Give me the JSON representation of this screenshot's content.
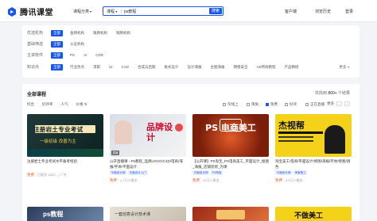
{
  "header": {
    "logo_text": "腾讯课堂",
    "category_label": "课程分类",
    "search_type": "课程",
    "search_value": "ps教程",
    "search_button": "搜索",
    "links": [
      "客户端",
      "浏览历史",
      "登录"
    ]
  },
  "filters": [
    {
      "label": "优选机构",
      "options": [
        "全部",
        "金牌机构",
        "银牌机构",
        "铜牌机构"
      ],
      "more": ""
    },
    {
      "label": "基础筛选",
      "options": [
        "全部",
        "认证机构"
      ],
      "more": ""
    },
    {
      "label": "主讲软件",
      "options": [
        "全部",
        "PS",
        "AI",
        "CDR"
      ],
      "more": ""
    },
    {
      "label": "知识点",
      "options": [
        "全部",
        "行业热点",
        "求职",
        "UI",
        "CAD",
        "合成与后期",
        "板式设计",
        "设计海报",
        "主图海报",
        "网络安全",
        "AE特效教程",
        "产品精修"
      ],
      "more": "更多 ∨"
    }
  ],
  "courses": {
    "title": "全部课程",
    "count_prefix": "共找到",
    "count": "800+",
    "count_suffix": "个结果",
    "sort_options": [
      "综合",
      "好评率",
      "人气",
      "价格 ⇅"
    ],
    "checks": [
      {
        "label": "仅线上",
        "on": false
      },
      {
        "label": "限免",
        "on": false
      },
      {
        "label": "免费",
        "on": true
      },
      {
        "label": "好评",
        "on": false
      },
      {
        "label": "正在直播",
        "on": false
      }
    ],
    "more": "更多",
    "page": "1/25",
    "items": [
      {
        "title": "注册岩土专业考试水平备考经验",
        "tags": [],
        "price": "免费",
        "meta": "已报名 158人",
        "extra": "广东",
        "thumb_text": "注册岩土专业考试",
        "thumb_sub": "一级初级 改善为主",
        "thumb_badge": ""
      },
      {
        "title": "公开直播课 --Ps教程_品牌LOGO/C4D/电商/海报/字体/平面设计",
        "tags": [
          "平面设计师",
          "平面设计入门"
        ],
        "price": "免费",
        "meta": "1.7万人报名",
        "extra": "",
        "thumb_text": "品牌设计",
        "thumb_sub": "",
        "thumb_badge": "直播"
      },
      {
        "title": "【公开课】PS淘宝_PS电商美工_平面设计_抠图_海报_店铺装修_为课",
        "tags": [
          "平面设计师",
          "PS淘宝"
        ],
        "price": "免费",
        "meta": "14万人报名",
        "extra": "",
        "thumb_text": "PS 电商美工",
        "thumb_sub": "",
        "thumb_badge": ""
      },
      {
        "title": "淘宝美工/电商/平面设计/修图/海报/字体/修图/调色",
        "tags": [
          "平面设计师",
          "淘宝美工"
        ],
        "price": "免费",
        "meta": "3.5万人报名",
        "extra": "",
        "thumb_text": "杰视帮",
        "thumb_sub": "",
        "thumb_badge": ""
      }
    ],
    "row2": [
      {
        "text": "ps教程"
      },
      {
        "text": "一套创意设计技术课"
      },
      {
        "text": ""
      },
      {
        "text": "不做美工"
      }
    ]
  },
  "colors": {
    "accent": "#1a57e8",
    "free": "#ff5a1f"
  }
}
